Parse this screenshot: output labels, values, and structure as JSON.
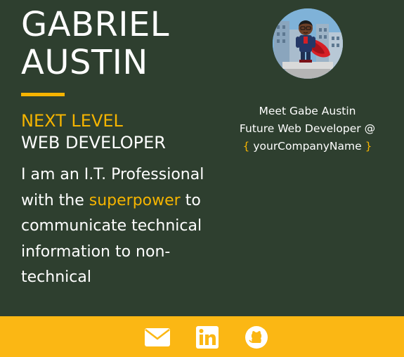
{
  "profile": {
    "name_line1": "GABRIEL",
    "name_line2": "AUSTIN",
    "tagline_line1": "NEXT LEVEL",
    "tagline_line2": "WEB DEVELOPER",
    "bio_before": "I am an I.T. Professional with the ",
    "bio_highlight": "superpower",
    "bio_after": " to communicate technical information to non-technical"
  },
  "sidebar": {
    "meet_line": "Meet Gabe Austin",
    "role_line": "Future Web Developer @",
    "open_brace": "{",
    "company": " yourCompanyName ",
    "close_brace": "}"
  },
  "footer": {
    "icons": [
      "email-icon",
      "linkedin-icon",
      "github-icon"
    ]
  },
  "colors": {
    "background": "#2e3f2f",
    "accent": "#f5b400",
    "footer": "#fbb714",
    "text": "#ffffff"
  }
}
